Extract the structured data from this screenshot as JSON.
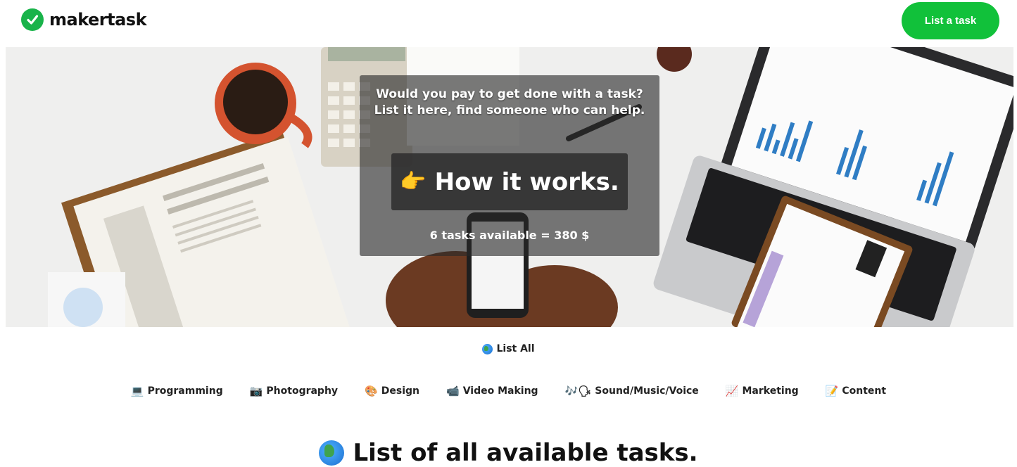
{
  "header": {
    "logo_text": "makertask",
    "list_task_label": "List a task"
  },
  "hero": {
    "tagline_line1": "Would you pay to get done with a task?",
    "tagline_line2": "List it here, find someone who can help.",
    "how_it_works_label": "How it works.",
    "tasks_summary": "6 tasks available = 380 $"
  },
  "categories": {
    "list_all": "List All",
    "items": [
      {
        "label": "Programming",
        "icon": "laptop-icon"
      },
      {
        "label": "Photography",
        "icon": "camera-icon"
      },
      {
        "label": "Design",
        "icon": "palette-icon"
      },
      {
        "label": "Video Making",
        "icon": "video-camera-icon"
      },
      {
        "label": "Sound/Music/Voice",
        "icon": "music-notes-icon"
      },
      {
        "label": "Marketing",
        "icon": "chart-up-icon"
      },
      {
        "label": "Content",
        "icon": "memo-icon"
      }
    ]
  },
  "section": {
    "title": "List of all available tasks."
  },
  "colors": {
    "brand_green": "#11c13a",
    "logo_green": "#19b34a"
  }
}
